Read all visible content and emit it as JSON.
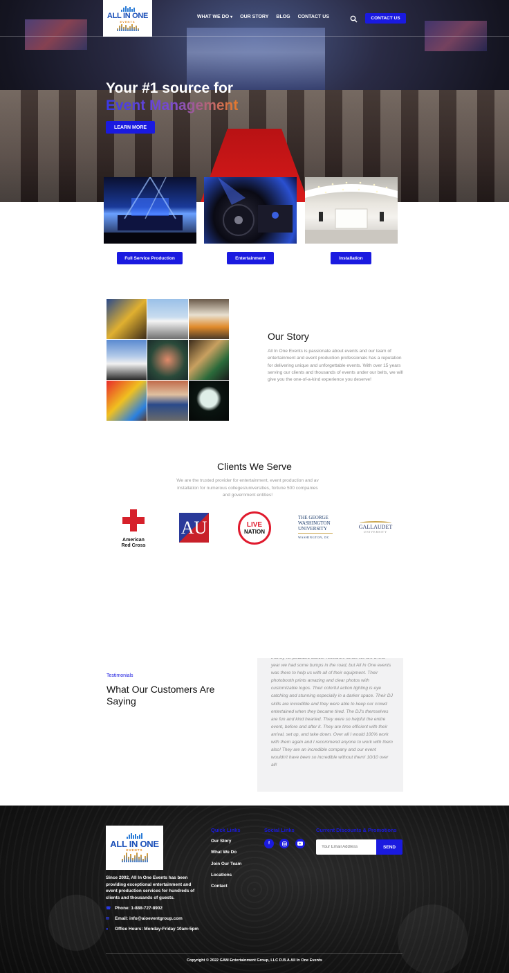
{
  "header": {
    "logo": {
      "main": "ALL IN ONE",
      "sub": "EVENTS",
      "tagline": "THE #1 SOURCE FOR EVENT MANAGEMENT"
    },
    "nav": [
      {
        "label": "WHAT WE DO",
        "has_dropdown": true
      },
      {
        "label": "OUR STORY"
      },
      {
        "label": "BLOG"
      },
      {
        "label": "CONTACT US"
      }
    ],
    "contact_button": "CONTACT US",
    "icons": {
      "search": "search-icon"
    }
  },
  "hero": {
    "line1": "Your #1 source for",
    "line2": "Event Management",
    "cta": "LEARN MORE"
  },
  "services": [
    {
      "label": "Full Service Production"
    },
    {
      "label": "Entertainment"
    },
    {
      "label": "Installation"
    }
  ],
  "story": {
    "title": "Our Story",
    "text": "All In One Events is passionate about events and our team of entertainment and event production professionals has a reputation for delivering unique and unforgettable events. With over 15 years serving our clients and thousands of events under our belts, we will give you the one-of-a-kind experience you deserve!"
  },
  "clients": {
    "title": "Clients We Serve",
    "text": "We are the trusted provider for entertainment, event production and av installation for numerous colleges/universities, fortune 500 companies and government entities!",
    "logos": {
      "red_cross": "American Red Cross",
      "au": "AU",
      "live_nation_1": "LIVE",
      "live_nation_2": "NATION",
      "gwu_1": "THE GEORGE",
      "gwu_2": "WASHINGTON",
      "gwu_3": "UNIVERSITY",
      "gwu_4": "WASHINGTON, DC",
      "gallaudet": "GALLAUDET",
      "gallaudet_sub": "UNIVERSITY"
    }
  },
  "testimonials": {
    "label": "Testimonials",
    "title": "What Our Customers Are Saying",
    "quote": "money for pediatric cancer research. Since we are a first year we had some bumps in the road, but All In One events was there to help us with all of their equipment. Their photobooth prints amazing and clear photos with customizable logos. Their colorful action lighting is eye catching and stunning especially in a darker space. Their DJ skills are incredible and they were able to keep our crowd entertained when they became tired. The DJ's themselves are fun and kind hearted. They were so helpful the entire event, before and after it. They are time efficient with their arrival, set up, and take down. Over all I would 100% work with them again and I recommend anyone to work with them also! They are an incredible company and our event wouldn't have been so incredible without them! 10/10 over all!"
  },
  "footer": {
    "about": "Since 2002, All In One Events has been providing exceptional entertainment and event production services for hundreds of clients and thousands of guests.",
    "phone": "Phone: 1-888-727-8902",
    "email": "Email: info@aioeventgroup.com",
    "hours": "Office Hours: Monday-Friday 10am-5pm",
    "quick_links_title": "Quick Links",
    "quick_links": [
      "Our Story",
      "What We Do",
      "Join Our Team",
      "Locations",
      "Contact"
    ],
    "social_title": "Social Links",
    "social": [
      "f",
      "ig",
      "yt"
    ],
    "discounts_title": "Current Discounts & Promotions",
    "email_placeholder": "Your Email Address",
    "send": "SEND",
    "copyright": "Copyright © 2022 GAM Entertainment Group, LLC D.B.A All In One Events"
  },
  "colors": {
    "accent": "#1a1ae0",
    "orange": "#e87a2a",
    "red": "#d6202a"
  }
}
